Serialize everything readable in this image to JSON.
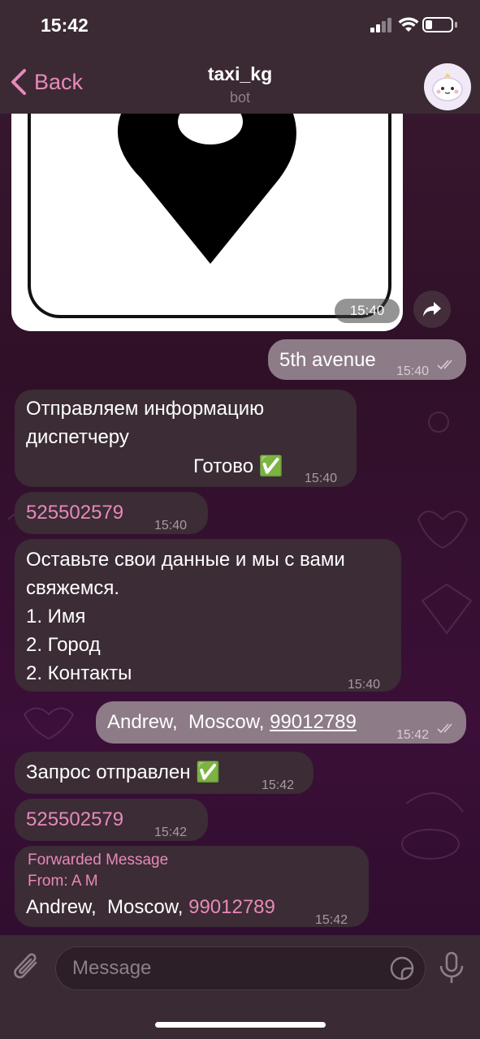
{
  "status_bar": {
    "time": "15:42"
  },
  "header": {
    "back_label": "Back",
    "title": "taxi_kg",
    "subtitle": "bot"
  },
  "messages": {
    "image_time": "15:40",
    "m1": {
      "text": "5th avenue",
      "time": "15:40"
    },
    "m2": {
      "line1": "Отправляем информацию",
      "line2": "диспетчеру",
      "line3": "Готово ✅",
      "time": "15:40"
    },
    "m3": {
      "text": "525502579",
      "time": "15:40"
    },
    "m4": {
      "line1": "Оставьте свои данные и мы с вами",
      "line2": "свяжемся.",
      "line3": "1. Имя",
      "line4": "2. Город",
      "line5": "2. Контакты",
      "time": "15:40"
    },
    "m5": {
      "text": "Andrew,  Moscow, ",
      "phone": "99012789",
      "time": "15:42"
    },
    "m6": {
      "text": "Запрос отправлен ✅",
      "time": "15:42"
    },
    "m7": {
      "text": "525502579",
      "time": "15:42"
    },
    "m8": {
      "fwd_label": "Forwarded Message",
      "fwd_from": "From: A M",
      "text": "Andrew,  Moscow, ",
      "phone": "99012789",
      "time": "15:42"
    }
  },
  "input": {
    "placeholder": "Message"
  },
  "icons": {
    "back": "chevron-left-icon",
    "share": "share-arrow-icon",
    "attach": "paperclip-icon",
    "sticker": "sticker-icon",
    "mic": "microphone-icon"
  },
  "colors": {
    "accent": "#e889b9",
    "incoming_bubble": "#3b2c35",
    "outgoing_bubble": "#8d7b88"
  }
}
